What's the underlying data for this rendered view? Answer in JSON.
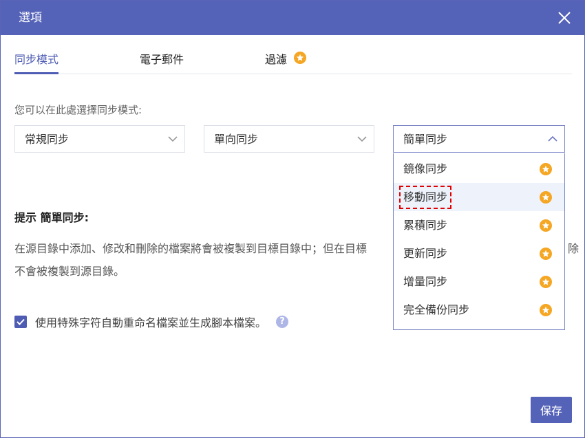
{
  "dialog": {
    "title": "選項",
    "close_icon": "close-icon"
  },
  "tabs": [
    {
      "label": "同步模式",
      "active": true
    },
    {
      "label": "電子郵件",
      "active": false
    },
    {
      "label": "過濾",
      "active": false,
      "premium_icon": "star-badge-icon"
    }
  ],
  "sync_mode": {
    "description": "您可以在此處選擇同步模式:",
    "selects": [
      {
        "value": "常規同步",
        "open": false
      },
      {
        "value": "單向同步",
        "open": false
      },
      {
        "value": "簡單同步",
        "open": true
      }
    ],
    "dropdown_options": [
      {
        "label": "鏡像同步",
        "premium": true
      },
      {
        "label": "移動同步",
        "premium": true,
        "hovered": true,
        "highlighted": true
      },
      {
        "label": "累積同步",
        "premium": true
      },
      {
        "label": "更新同步",
        "premium": true
      },
      {
        "label": "增量同步",
        "premium": true
      },
      {
        "label": "完全備份同步",
        "premium": true
      }
    ]
  },
  "tip": {
    "title": "提示 簡單同步:",
    "body_line1": "在源目錄中添加、修改和刪除的檔案將會被複製到目標目錄中；但在目標",
    "body_line1_tail": "除",
    "body_line2": "不會被複製到源目錄。"
  },
  "option": {
    "checked": true,
    "label": "使用特殊字符自動重命名檔案並生成腳本檔案。",
    "help_icon": "?"
  },
  "buttons": {
    "save_label": "保存"
  },
  "colors": {
    "accent": "#5462b8",
    "premium_star": "#f5a623",
    "highlight_border": "#e00000"
  }
}
